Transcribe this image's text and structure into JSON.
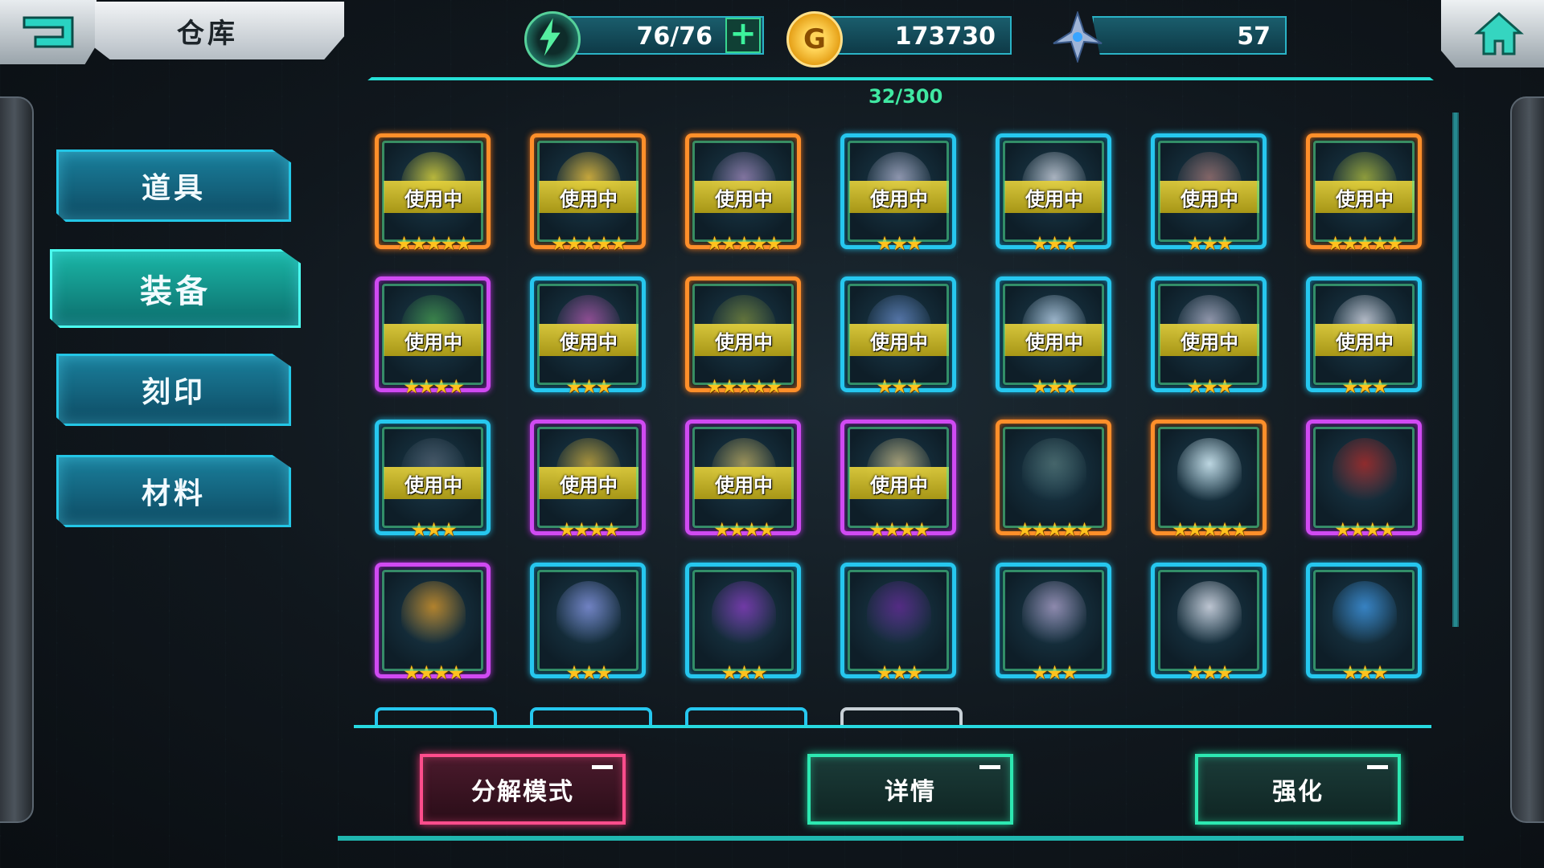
{
  "header": {
    "title": "仓库"
  },
  "resources": {
    "energy": "76/76",
    "gold": "173730",
    "gold_icon_label": "G",
    "crystal": "57"
  },
  "capacity": "32/300",
  "tabs": [
    {
      "label": "道具",
      "active": false
    },
    {
      "label": "装备",
      "active": true
    },
    {
      "label": "刻印",
      "active": false
    },
    {
      "label": "材料",
      "active": false
    }
  ],
  "in_use_label": "使用中",
  "items": [
    {
      "rarity": "orange",
      "in_use": true,
      "stars": "★★★★★",
      "art": "yellow-armor"
    },
    {
      "rarity": "orange",
      "in_use": true,
      "stars": "★★★★★",
      "art": "gold-wings"
    },
    {
      "rarity": "orange",
      "in_use": true,
      "stars": "★★★★★",
      "art": "mech-armor"
    },
    {
      "rarity": "blue",
      "in_use": true,
      "stars": "★★★",
      "art": "badge"
    },
    {
      "rarity": "blue",
      "in_use": true,
      "stars": "★★★",
      "art": "white-mech"
    },
    {
      "rarity": "blue",
      "in_use": true,
      "stars": "★★★",
      "art": "red-mech"
    },
    {
      "rarity": "orange",
      "in_use": true,
      "stars": "★★★★★",
      "art": "green-shield"
    },
    {
      "rarity": "purple",
      "in_use": true,
      "stars": "★★★★",
      "art": "green-helmet"
    },
    {
      "rarity": "blue",
      "in_use": true,
      "stars": "★★★",
      "art": "pink-mech"
    },
    {
      "rarity": "orange",
      "in_use": true,
      "stars": "★★★★★",
      "art": "shield"
    },
    {
      "rarity": "blue",
      "in_use": true,
      "stars": "★★★",
      "art": "blue-mech"
    },
    {
      "rarity": "blue",
      "in_use": true,
      "stars": "★★★",
      "art": "wings"
    },
    {
      "rarity": "blue",
      "in_use": true,
      "stars": "★★★",
      "art": "silver-badge"
    },
    {
      "rarity": "blue",
      "in_use": true,
      "stars": "★★★",
      "art": "white-armor"
    },
    {
      "rarity": "blue",
      "in_use": true,
      "stars": "★★★",
      "art": "dark-helmet"
    },
    {
      "rarity": "purple",
      "in_use": true,
      "stars": "★★★★",
      "art": "gold-ring"
    },
    {
      "rarity": "purple",
      "in_use": true,
      "stars": "★★★★",
      "art": "gold-armor"
    },
    {
      "rarity": "purple",
      "in_use": true,
      "stars": "★★★★",
      "art": "gold-mech"
    },
    {
      "rarity": "orange",
      "in_use": false,
      "stars": "★★★★★",
      "art": "sword-shield"
    },
    {
      "rarity": "orange",
      "in_use": false,
      "stars": "★★★★★",
      "art": "angel-wing"
    },
    {
      "rarity": "purple",
      "in_use": false,
      "stars": "★★★★",
      "art": "red-cape"
    },
    {
      "rarity": "purple",
      "in_use": false,
      "stars": "★★★★",
      "art": "ring"
    },
    {
      "rarity": "blue",
      "in_use": false,
      "stars": "★★★",
      "art": "mech-suit"
    },
    {
      "rarity": "blue",
      "in_use": false,
      "stars": "★★★",
      "art": "purple-emblem"
    },
    {
      "rarity": "blue",
      "in_use": false,
      "stars": "★★★",
      "art": "purple-helmet"
    },
    {
      "rarity": "blue",
      "in_use": false,
      "stars": "★★★",
      "art": "star-badge"
    },
    {
      "rarity": "blue",
      "in_use": false,
      "stars": "★★★",
      "art": "white-mech-suit"
    },
    {
      "rarity": "blue",
      "in_use": false,
      "stars": "★★★",
      "art": "blue-shield"
    }
  ],
  "buttons": {
    "decompose": "分解模式",
    "details": "详情",
    "enhance": "强化"
  },
  "colors": {
    "accent": "#26e0d6",
    "orange": "#ff8f2a",
    "blue": "#26c7ef",
    "purple": "#d04af2",
    "pink": "#ff4d8c",
    "star": "#ffc21e",
    "art": {
      "yellow-armor": "#c9c43a",
      "gold-wings": "#d8b23a",
      "mech-armor": "#8c7aa8",
      "badge": "#9a9fb8",
      "white-mech": "#b9c0cc",
      "red-mech": "#8e6a6a",
      "green-shield": "#9aa63a",
      "green-helmet": "#3e8a4a",
      "pink-mech": "#9a4f9a",
      "shield": "#6a7a3a",
      "blue-mech": "#5a7ab0",
      "wings": "#a8c0d6",
      "silver-badge": "#9c9fb4",
      "white-armor": "#c2c6d2",
      "dark-helmet": "#4a5a6a",
      "gold-ring": "#b59a3a",
      "gold-armor": "#a89a5a",
      "gold-mech": "#b0a67a",
      "sword-shield": "#4a6a6e",
      "angel-wing": "#cfe8f2",
      "red-cape": "#9c2a2a",
      "ring": "#c28a2a",
      "mech-suit": "#7a8ad0",
      "purple-emblem": "#7a3ab0",
      "purple-helmet": "#5a2a8a",
      "star-badge": "#9a92b8",
      "white-mech-suit": "#cfd4e0",
      "blue-shield": "#3a8ad0"
    }
  }
}
